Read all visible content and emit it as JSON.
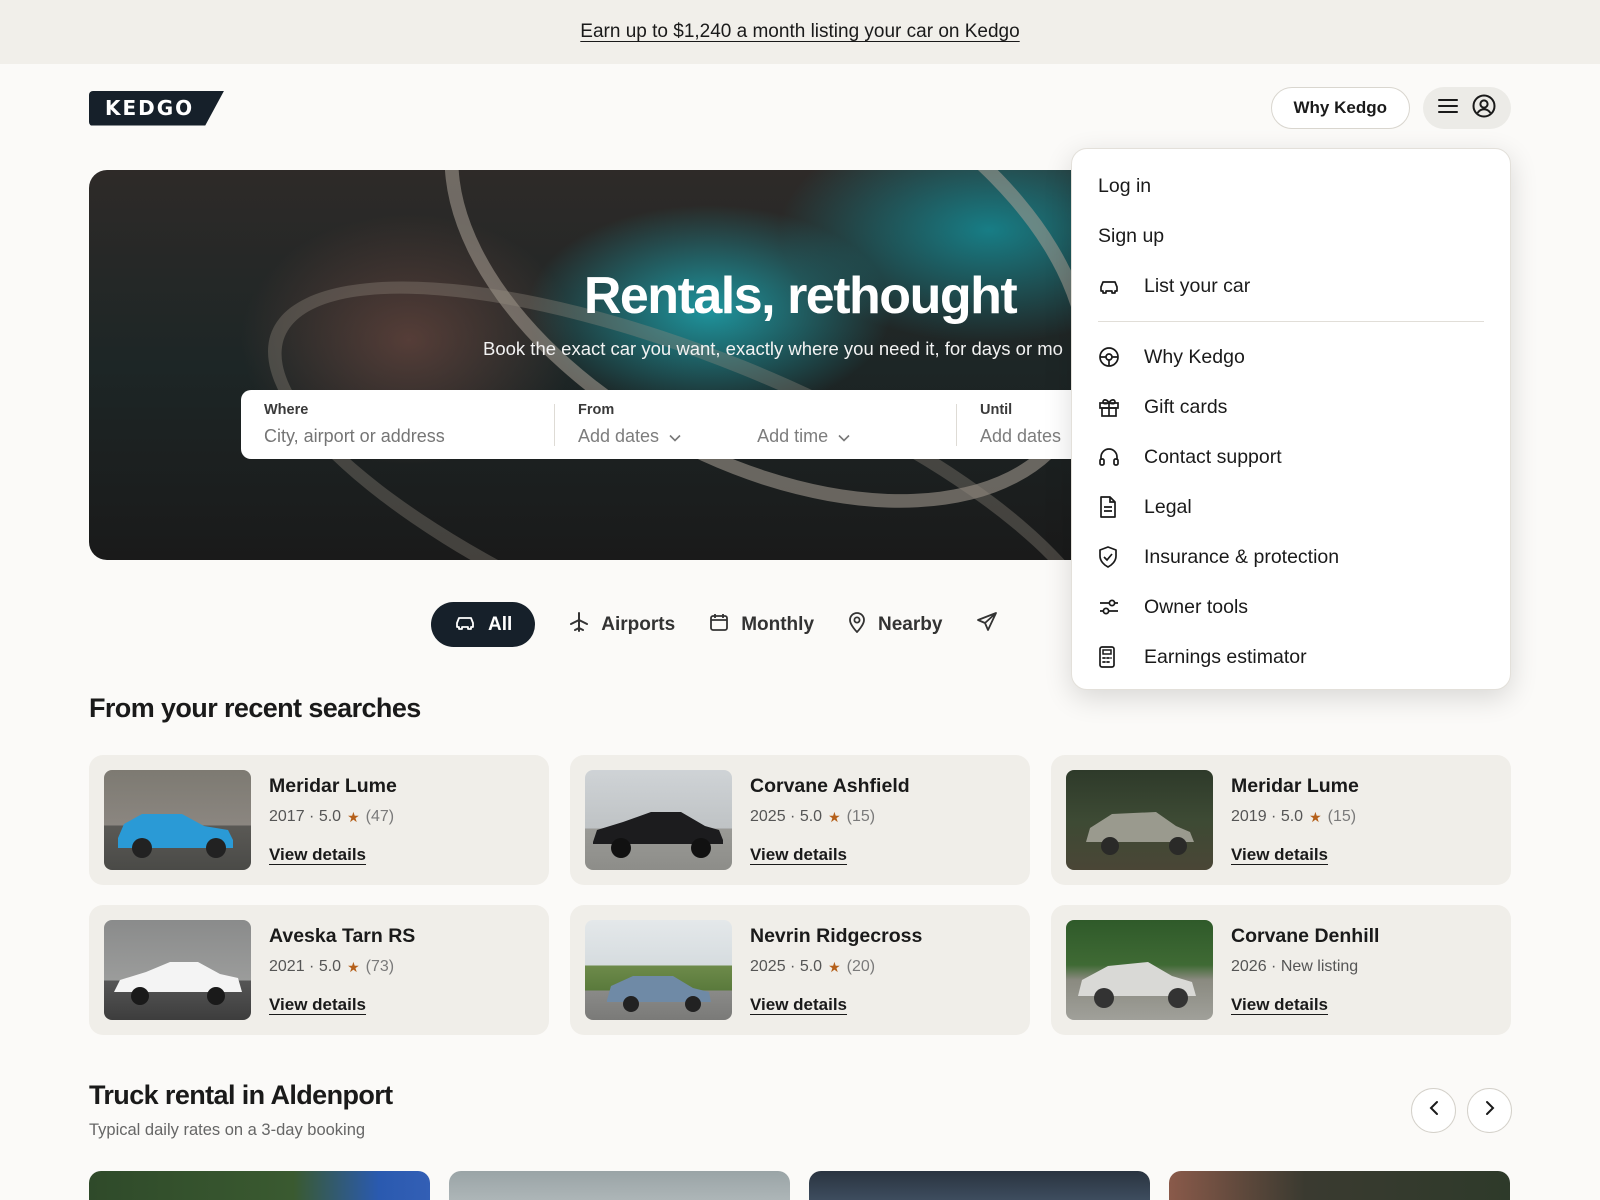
{
  "promo": {
    "text": "Earn up to $1,240 a month listing your car on Kedgo"
  },
  "header": {
    "logo": "KEDGO",
    "why_button": "Why Kedgo"
  },
  "menu": {
    "items_top": [
      {
        "label": "Log in",
        "icon": ""
      },
      {
        "label": "Sign up",
        "icon": ""
      },
      {
        "label": "List your car",
        "icon": "car-icon"
      }
    ],
    "items_bottom": [
      {
        "label": "Why Kedgo",
        "icon": "steering-wheel-icon"
      },
      {
        "label": "Gift cards",
        "icon": "gift-icon"
      },
      {
        "label": "Contact support",
        "icon": "headphones-icon"
      },
      {
        "label": "Legal",
        "icon": "document-icon"
      },
      {
        "label": "Insurance & protection",
        "icon": "shield-icon"
      },
      {
        "label": "Owner tools",
        "icon": "sliders-icon"
      },
      {
        "label": "Earnings estimator",
        "icon": "calculator-icon"
      }
    ]
  },
  "hero": {
    "title": "Rentals, rethought",
    "subtitle": "Book the exact car you want, exactly where you need it, for days or mo"
  },
  "search": {
    "where_label": "Where",
    "where_placeholder": "City, airport or address",
    "from_label": "From",
    "from_dates": "Add dates",
    "from_time": "Add time",
    "until_label": "Until",
    "until_dates": "Add dates"
  },
  "filters": [
    {
      "label": "All",
      "icon": "car-icon",
      "active": true
    },
    {
      "label": "Airports",
      "icon": "airplane-icon",
      "active": false
    },
    {
      "label": "Monthly",
      "icon": "calendar-icon",
      "active": false
    },
    {
      "label": "Nearby",
      "icon": "location-pin-icon",
      "active": false
    },
    {
      "label": "",
      "icon": "send-icon",
      "active": false
    }
  ],
  "recent": {
    "title": "From your recent searches",
    "cards": [
      {
        "name": "Meridar Lume",
        "year": "2017 · 5.0",
        "reviews": "(47)",
        "link": "View details",
        "color": "#2a9ad6"
      },
      {
        "name": "Corvane Ashfield",
        "year": "2025 · 5.0",
        "reviews": "(15)",
        "link": "View details",
        "color": "#1c1c1e"
      },
      {
        "name": "Meridar Lume",
        "year": "2019 · 5.0",
        "reviews": "(15)",
        "link": "View details",
        "color": "#9a9a8e"
      },
      {
        "name": "Aveska Tarn RS",
        "year": "2021 · 5.0",
        "reviews": "(73)",
        "link": "View details",
        "color": "#f4f4f4"
      },
      {
        "name": "Nevrin Ridgecross",
        "year": "2025 · 5.0",
        "reviews": "(20)",
        "link": "View details",
        "color": "#6f8aa6"
      },
      {
        "name": "Corvane Denhill",
        "year": "2026 · New listing",
        "reviews": "",
        "link": "View details",
        "color": "#d9d9d6"
      }
    ]
  },
  "trucks": {
    "title": "Truck rental in Aldenport",
    "subtitle": "Typical daily rates on a 3-day booking"
  }
}
